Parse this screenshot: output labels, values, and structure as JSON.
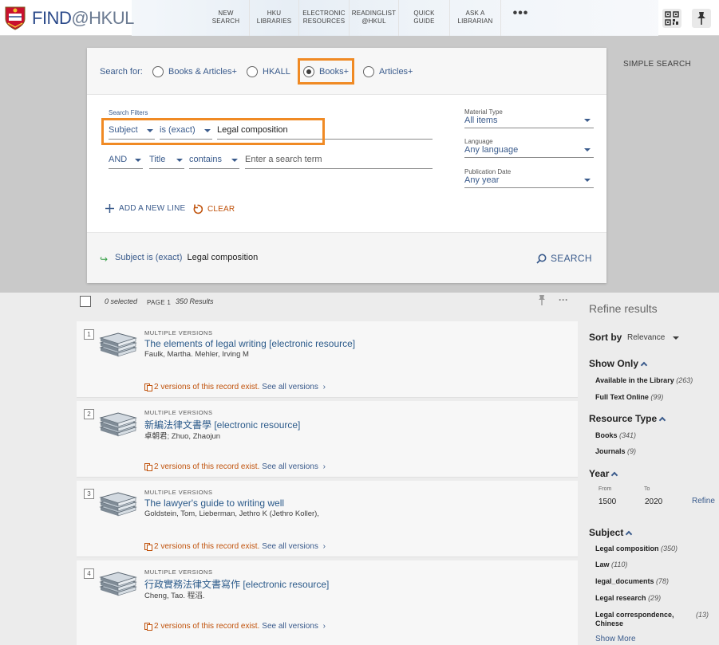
{
  "header": {
    "logo_text_find": "FIND",
    "logo_text_hkul": "@HKUL",
    "nav": [
      {
        "line1": "NEW",
        "line2": "SEARCH"
      },
      {
        "line1": "HKU",
        "line2": "LIBRARIES"
      },
      {
        "line1": "ELECTRONIC",
        "line2": "RESOURCES"
      },
      {
        "line1": "READINGLIST",
        "line2": "@HKUL"
      },
      {
        "line1": "QUICK",
        "line2": "GUIDE"
      },
      {
        "line1": "ASK A",
        "line2": "LIBRARIAN"
      }
    ],
    "more_label": "•••"
  },
  "search": {
    "simple_search_label": "SIMPLE SEARCH",
    "search_for_label": "Search for:",
    "scopes": [
      "Books & Articles+",
      "HKALL",
      "Books+",
      "Articles+"
    ],
    "selected_scope": "Books+",
    "filters_label": "Search Filters",
    "line1": {
      "field": "Subject",
      "operator": "is (exact)",
      "value": "Legal composition"
    },
    "line2": {
      "boolean": "AND",
      "field": "Title",
      "operator": "contains",
      "placeholder": "Enter a search term"
    },
    "material_type_label": "Material Type",
    "material_type_value": "All items",
    "language_label": "Language",
    "language_value": "Any language",
    "pub_date_label": "Publication Date",
    "pub_date_value": "Any year",
    "add_line_label": "ADD A NEW LINE",
    "clear_label": "CLEAR",
    "summary_field": "Subject",
    "summary_operator": "is (exact)",
    "summary_value": "Legal composition",
    "search_button_label": "SEARCH"
  },
  "results_toolbar": {
    "selected": "0 selected",
    "page": "PAGE 1",
    "results": "350 Results"
  },
  "results": [
    {
      "num": "1",
      "type": "MULTIPLE VERSIONS",
      "title": "The elements of legal writing [electronic resource]",
      "author": "Faulk, Martha. Mehler, Irving M",
      "versions": "2 versions of this record exist.",
      "see_all": "See all versions"
    },
    {
      "num": "2",
      "type": "MULTIPLE VERSIONS",
      "title": "新編法律文書學 [electronic resource]",
      "author": "卓朝君; Zhuo, Zhaojun",
      "versions": "2 versions of this record exist.",
      "see_all": "See all versions"
    },
    {
      "num": "3",
      "type": "MULTIPLE VERSIONS",
      "title": "The lawyer's guide to writing well",
      "author": "Goldstein, Tom, Lieberman, Jethro K (Jethro Koller),",
      "versions": "2 versions of this record exist.",
      "see_all": "See all versions"
    },
    {
      "num": "4",
      "type": "MULTIPLE VERSIONS",
      "title": "行政實務法律文書寫作 [electronic resource]",
      "author": "Cheng, Tao. 程滔.",
      "versions": "2 versions of this record exist.",
      "see_all": "See all versions"
    }
  ],
  "refine": {
    "title": "Refine results",
    "sort_label": "Sort by",
    "sort_value": "Relevance",
    "show_only_label": "Show Only",
    "show_only": [
      {
        "label": "Available in the Library",
        "count": "(263)"
      },
      {
        "label": "Full Text Online",
        "count": "(99)"
      }
    ],
    "resource_type_label": "Resource Type",
    "resource_types": [
      {
        "label": "Books",
        "count": "(341)"
      },
      {
        "label": "Journals",
        "count": "(9)"
      }
    ],
    "year_label": "Year",
    "year_from_label": "From",
    "year_to_label": "To",
    "year_from": "1500",
    "year_to": "2020",
    "refine_link": "Refine",
    "subject_label": "Subject",
    "subjects": [
      {
        "label": "Legal composition",
        "count": "(350)"
      },
      {
        "label": "Law",
        "count": "(110)"
      },
      {
        "label": "legal_documents",
        "count": "(78)"
      },
      {
        "label": "Legal research",
        "count": "(29)"
      },
      {
        "label": "Legal correspondence,",
        "label2": "Chinese",
        "count": "(13)"
      }
    ],
    "show_more": "Show More"
  },
  "colors": {
    "accent_orange": "#f08a24",
    "link_blue": "#2b5a8a",
    "clear_orange": "#c0520b"
  }
}
